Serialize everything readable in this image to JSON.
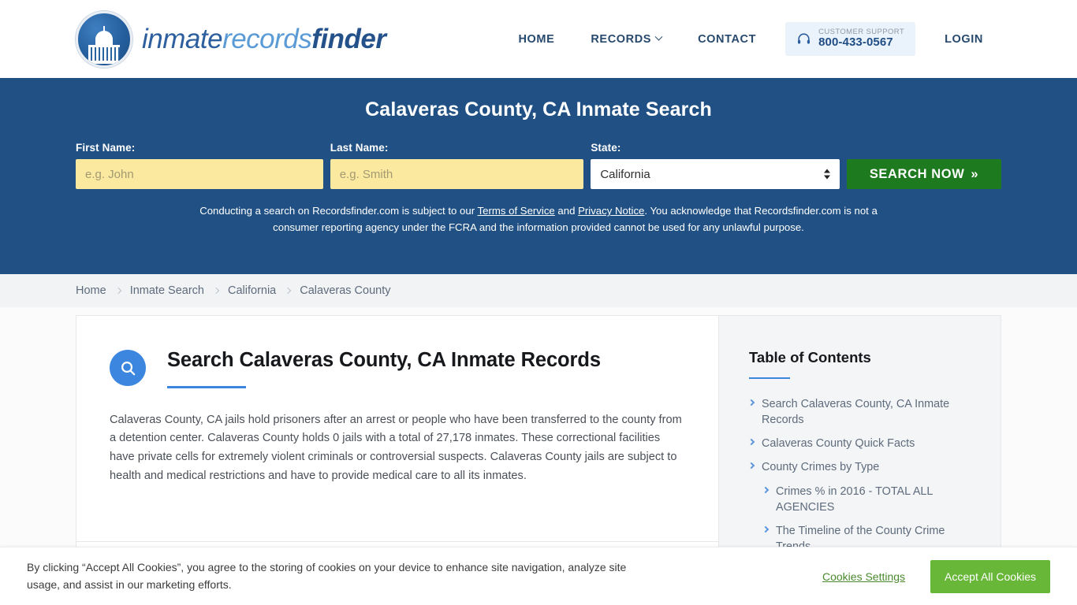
{
  "header": {
    "brand": {
      "part1": "inmate",
      "part2": "records",
      "part3": "finder",
      "logo_icon": "capitol-dome-icon"
    },
    "nav": [
      {
        "label": "HOME",
        "name": "nav-home"
      },
      {
        "label": "RECORDS",
        "name": "nav-records",
        "has_dropdown": true
      },
      {
        "label": "CONTACT",
        "name": "nav-contact"
      }
    ],
    "support": {
      "icon": "headset-icon",
      "label": "CUSTOMER SUPPORT",
      "phone": "800-433-0567"
    },
    "login_label": "LOGIN"
  },
  "hero": {
    "title": "Calaveras County, CA Inmate Search",
    "first_name_label": "First Name:",
    "first_name_placeholder": "e.g. John",
    "first_name_value": "",
    "last_name_label": "Last Name:",
    "last_name_placeholder": "e.g. Smith",
    "last_name_value": "",
    "state_label": "State:",
    "state_value": "California",
    "state_options": [
      "California"
    ],
    "search_button": "SEARCH NOW",
    "search_button_chevrons": "»",
    "disclaimer_part1": "Conducting a search on Recordsfinder.com is subject to our ",
    "disclaimer_link1": "Terms of Service",
    "disclaimer_part2": " and ",
    "disclaimer_link2": "Privacy Notice",
    "disclaimer_part3": ". You acknowledge that Recordsfinder.com is not a consumer reporting agency under the FCRA and the information provided cannot be used for any unlawful purpose.",
    "bg_color": "#215184",
    "input_color": "#fbe9a0",
    "button_color": "#1e7a1e"
  },
  "breadcrumb": [
    {
      "label": "Home"
    },
    {
      "label": "Inmate Search"
    },
    {
      "label": "California"
    },
    {
      "label": "Calaveras County"
    }
  ],
  "main": {
    "icon": "search-icon",
    "heading": "Search Calaveras County, CA Inmate Records",
    "paragraph": "Calaveras County, CA jails hold prisoners after an arrest or people who have been transferred to the county from a detention center. Calaveras County holds 0 jails with a total of 27,178 inmates. These correctional facilities have private cells for extremely violent criminals or controversial suspects. Calaveras County jails are subject to health and medical restrictions and have to provide medical care to all its inmates.",
    "accent_color": "#3c86df"
  },
  "sidebar": {
    "title": "Table of Contents",
    "items": [
      {
        "label": "Search Calaveras County, CA Inmate Records",
        "sub": false
      },
      {
        "label": "Calaveras County Quick Facts",
        "sub": false
      },
      {
        "label": "County Crimes by Type",
        "sub": false
      },
      {
        "label": "Crimes % in 2016 - TOTAL ALL AGENCIES",
        "sub": true
      },
      {
        "label": "The Timeline of the County Crime Trends",
        "sub": true
      }
    ]
  },
  "cookie_banner": {
    "text": "By clicking “Accept All Cookies”, you agree to the storing of cookies on your device to enhance site navigation, analyze site usage, and assist in our marketing efforts.",
    "settings_label": "Cookies Settings",
    "accept_label": "Accept All Cookies",
    "accept_color": "#68b738"
  }
}
